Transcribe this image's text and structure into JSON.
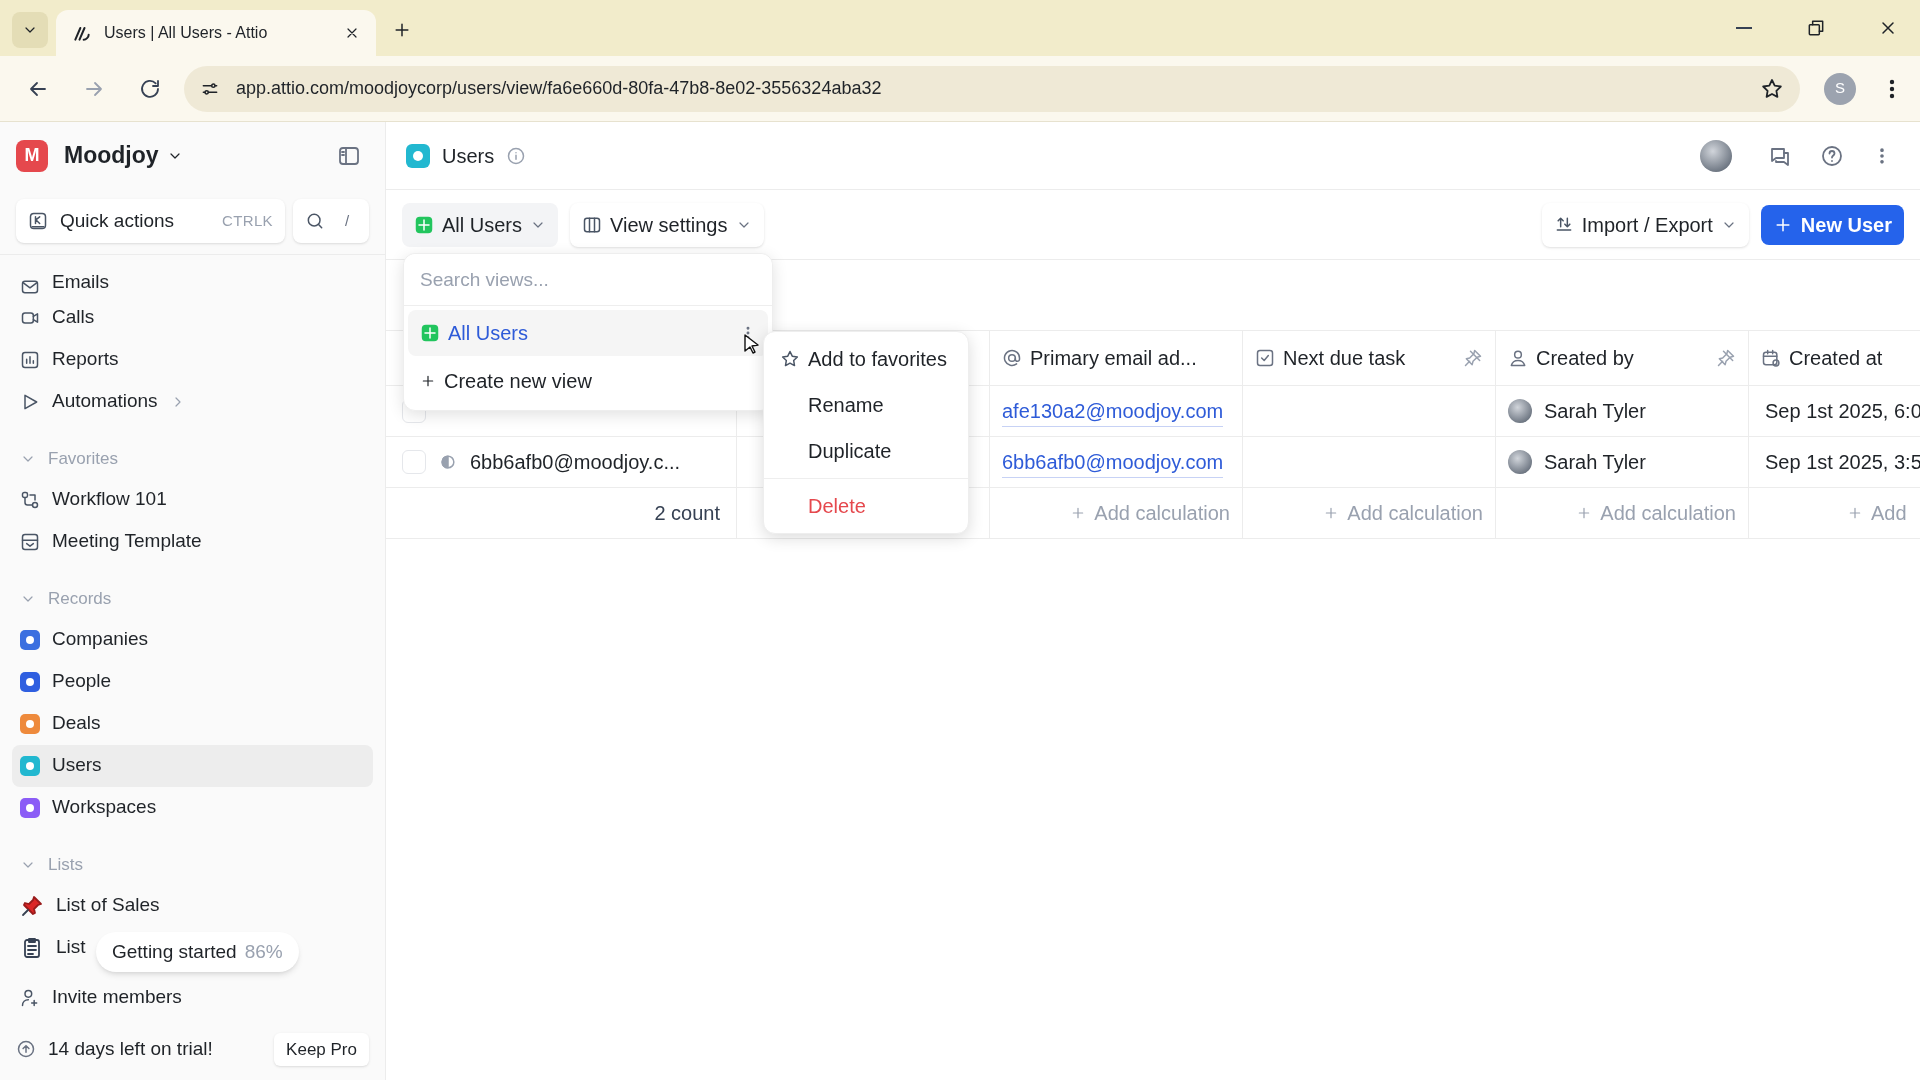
{
  "browser": {
    "tabs": [
      {
        "title": "Users | All Users - Attio",
        "selected": true
      }
    ],
    "url": "app.attio.com/moodjoycorp/users/view/fa6e660d-80fa-47b8-8e02-3556324aba32",
    "profile": "S"
  },
  "sidebar": {
    "workspace": "Moodjoy",
    "workspace_initial": "M",
    "quick_actions": {
      "label": "Quick actions",
      "shortcut": "CTRLK",
      "search_shortcut": "/"
    },
    "nav": [
      {
        "label": "Emails",
        "kind": "mail"
      },
      {
        "label": "Calls",
        "kind": "video"
      },
      {
        "label": "Reports",
        "kind": "chart"
      },
      {
        "label": "Automations",
        "kind": "play"
      }
    ],
    "sections": [
      {
        "title": "Favorites",
        "expanded": true,
        "items": [
          {
            "label": "Workflow 101",
            "kind": "flow",
            "selected": false
          },
          {
            "label": "Meeting Template",
            "kind": "template",
            "selected": false
          }
        ]
      },
      {
        "title": "Records",
        "expanded": true,
        "items": [
          {
            "label": "Companies",
            "kind": "record",
            "color": "#3b6fe0",
            "selected": false
          },
          {
            "label": "People",
            "kind": "record",
            "color": "#2f5fe0",
            "selected": false
          },
          {
            "label": "Deals",
            "kind": "record",
            "color": "#ee8a3c",
            "selected": false
          },
          {
            "label": "Users",
            "kind": "record",
            "color": "#22b8d0",
            "selected": true
          },
          {
            "label": "Workspaces",
            "kind": "record",
            "color": "#8b5cf6",
            "selected": false
          }
        ]
      },
      {
        "title": "Lists",
        "expanded": true,
        "items": [
          {
            "label": "List of Sales",
            "kind": "pin",
            "selected": false
          },
          {
            "label": "List",
            "kind": "clipboard",
            "selected": false
          }
        ]
      }
    ],
    "invite": "Invite members",
    "trial": {
      "text": "14 days left on trial!",
      "button": "Keep Pro"
    }
  },
  "toast": {
    "label": "Getting started",
    "percent": "86%"
  },
  "header": {
    "title": "Users"
  },
  "toolbar": {
    "view": "All Users",
    "view_settings": "View settings",
    "import_export": "Import / Export",
    "new": "New User"
  },
  "view_menu": {
    "placeholder": "Search views...",
    "views": [
      {
        "label": "All Users",
        "selected": true
      }
    ],
    "create": "Create new view"
  },
  "context_menu": [
    {
      "label": "Add to favorites",
      "kind": "star"
    },
    {
      "label": "Rename",
      "kind": "plain"
    },
    {
      "label": "Duplicate",
      "kind": "plain"
    },
    {
      "label": "Delete",
      "kind": "danger"
    }
  ],
  "table": {
    "columns": [
      {
        "label": "Primary email ad...",
        "kind": "at",
        "pinned": false
      },
      {
        "label": "Next due task",
        "kind": "task",
        "pinned": true
      },
      {
        "label": "Created by",
        "kind": "person",
        "pinned": true
      },
      {
        "label": "Created at",
        "kind": "calendar",
        "pinned": false
      }
    ],
    "rows": [
      {
        "checked": false,
        "name": null,
        "email": "afe130a2@moodjoy.com",
        "created_by": "Sarah Tyler",
        "created_at": "Sep 1st 2025, 6:0"
      },
      {
        "checked": false,
        "name": "6bb6afb0@moodjoy.c...",
        "email": "6bb6afb0@moodjoy.com",
        "created_by": "Sarah Tyler",
        "created_at": "Sep 1st 2025, 3:5"
      }
    ],
    "footer": {
      "count": "2 count",
      "calculations": [
        "Add calculation",
        "Add calculation",
        "Add calculation",
        "Add"
      ]
    }
  }
}
